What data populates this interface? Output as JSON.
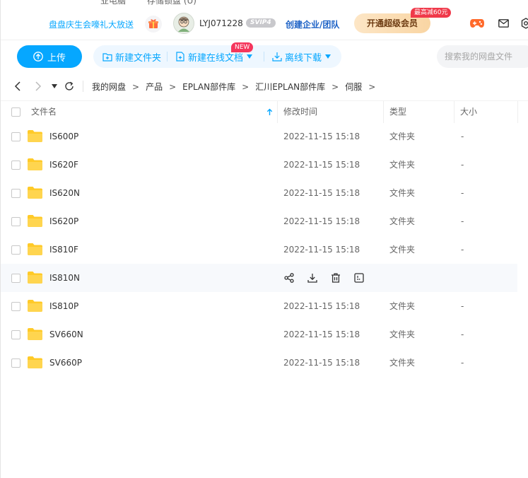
{
  "topbar": {
    "cut_text_1": "业电脑",
    "cut_text_2": "存储锁盘 (U)"
  },
  "header": {
    "promo": "盘盘庆生会嚎礼大放送",
    "username": "LYJ071228",
    "svip": "SVIP4",
    "enterprise": "创建企业/团队",
    "vip_button": "开通超级会员",
    "vip_discount": "最高减60元",
    "icons": [
      "gift-icon",
      "avatar",
      "game-icon",
      "mail-icon",
      "settings-icon"
    ]
  },
  "toolbar": {
    "upload": "上传",
    "new_folder": "新建文件夹",
    "new_doc": "新建在线文档",
    "new_badge": "NEW",
    "offline": "离线下载",
    "search_placeholder": "搜索我的网盘文件"
  },
  "breadcrumb": [
    "我的网盘",
    "产品",
    "EPLAN部件库",
    "汇川EPLAN部件库",
    "伺服"
  ],
  "breadcrumb_trailing": ">",
  "table": {
    "columns": [
      "文件名",
      "修改时间",
      "类型",
      "大小"
    ],
    "rows": [
      {
        "name": "IS600P",
        "time": "2022-11-15 15:18",
        "type": "文件夹",
        "size": "-"
      },
      {
        "name": "IS620F",
        "time": "2022-11-15 15:18",
        "type": "文件夹",
        "size": "-"
      },
      {
        "name": "IS620N",
        "time": "2022-11-15 15:18",
        "type": "文件夹",
        "size": "-"
      },
      {
        "name": "IS620P",
        "time": "2022-11-15 15:18",
        "type": "文件夹",
        "size": "-"
      },
      {
        "name": "IS810F",
        "time": "2022-11-15 15:18",
        "type": "文件夹",
        "size": "-"
      },
      {
        "name": "IS810N",
        "hovered": true
      },
      {
        "name": "IS810P",
        "time": "2022-11-15 15:18",
        "type": "文件夹",
        "size": "-"
      },
      {
        "name": "SV660N",
        "time": "2022-11-15 15:18",
        "type": "文件夹",
        "size": "-"
      },
      {
        "name": "SV660P",
        "time": "2022-11-15 15:18",
        "type": "文件夹",
        "size": "-"
      }
    ],
    "hover_actions": [
      "share-icon",
      "download-icon",
      "delete-icon",
      "more-icon"
    ]
  },
  "colors": {
    "accent": "#06a7ff",
    "folder": "#ffca28",
    "enterprise": "#1d62c6"
  }
}
